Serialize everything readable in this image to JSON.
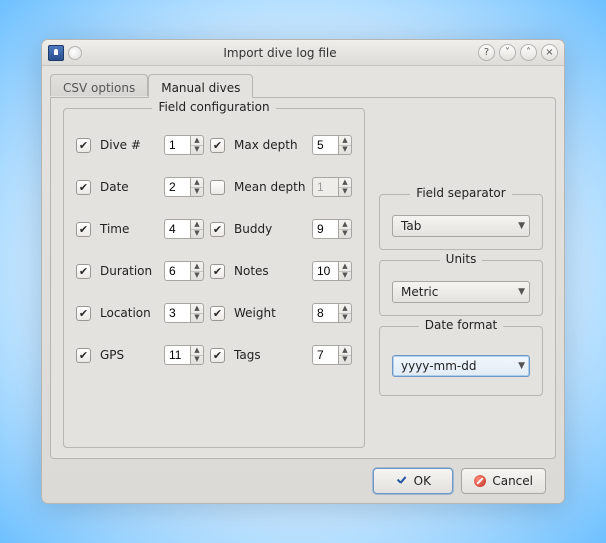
{
  "window": {
    "title": "Import dive log file"
  },
  "tabs": {
    "csv": "CSV options",
    "manual": "Manual dives"
  },
  "fieldset_title": "Field configuration",
  "fields": {
    "dive": {
      "label": "Dive #",
      "checked": true,
      "value": "1"
    },
    "maxdepth": {
      "label": "Max depth",
      "checked": true,
      "value": "5"
    },
    "date": {
      "label": "Date",
      "checked": true,
      "value": "2"
    },
    "meandepth": {
      "label": "Mean depth",
      "checked": false,
      "value": "1"
    },
    "time": {
      "label": "Time",
      "checked": true,
      "value": "4"
    },
    "buddy": {
      "label": "Buddy",
      "checked": true,
      "value": "9"
    },
    "duration": {
      "label": "Duration",
      "checked": true,
      "value": "6"
    },
    "notes": {
      "label": "Notes",
      "checked": true,
      "value": "10"
    },
    "location": {
      "label": "Location",
      "checked": true,
      "value": "3"
    },
    "weight": {
      "label": "Weight",
      "checked": true,
      "value": "8"
    },
    "gps": {
      "label": "GPS",
      "checked": true,
      "value": "11"
    },
    "tags": {
      "label": "Tags",
      "checked": true,
      "value": "7"
    }
  },
  "side": {
    "separator": {
      "title": "Field separator",
      "value": "Tab"
    },
    "units": {
      "title": "Units",
      "value": "Metric"
    },
    "dateformat": {
      "title": "Date format",
      "value": "yyyy-mm-dd"
    }
  },
  "buttons": {
    "ok": "OK",
    "cancel": "Cancel"
  }
}
